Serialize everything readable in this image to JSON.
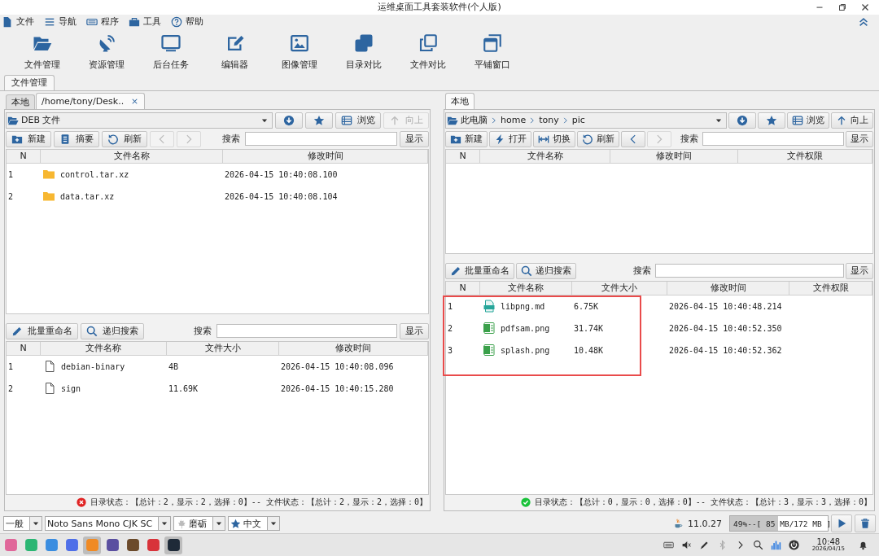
{
  "window": {
    "title": "运维桌面工具套装软件(个人版)"
  },
  "menu": [
    {
      "label": "文件",
      "kind": "file"
    },
    {
      "label": "导航",
      "kind": "menu"
    },
    {
      "label": "程序",
      "kind": "keyboard"
    },
    {
      "label": "工具",
      "kind": "toolbox"
    },
    {
      "label": "帮助",
      "kind": "help"
    }
  ],
  "toolbar": [
    {
      "label": "文件管理",
      "kind": "folder-open"
    },
    {
      "label": "资源管理",
      "kind": "satellite"
    },
    {
      "label": "后台任务",
      "kind": "monitor"
    },
    {
      "label": "编辑器",
      "kind": "edit"
    },
    {
      "label": "图像管理",
      "kind": "image"
    },
    {
      "label": "目录对比",
      "kind": "copy-filled"
    },
    {
      "label": "文件对比",
      "kind": "copy-outline"
    },
    {
      "label": "平铺窗口",
      "kind": "windows"
    }
  ],
  "main_tabs": [
    {
      "label": "文件管理",
      "selected": true
    }
  ],
  "panes": [
    {
      "tabs": [
        {
          "label": "本地",
          "selected": false,
          "closable": false
        },
        {
          "label": "/home/tony/Desk..",
          "selected": true,
          "closable": true
        }
      ],
      "path": [
        "DEB 文件"
      ],
      "nav": [
        {
          "kind": "download",
          "disabled": false
        },
        {
          "kind": "star",
          "disabled": false
        },
        {
          "label": "浏览",
          "kind": "list",
          "disabled": false
        },
        {
          "label": "向上",
          "kind": "up",
          "disabled": true
        }
      ],
      "toolbar": [
        {
          "label": "新建",
          "kind": "new",
          "disabled": false
        },
        {
          "label": "摘要",
          "kind": "summary",
          "disabled": false
        },
        {
          "label": "刷新",
          "kind": "refresh",
          "disabled": false
        },
        {
          "kind": "back",
          "disabled": true
        },
        {
          "kind": "forward",
          "disabled": true
        }
      ],
      "search_label": "搜索",
      "show_button": "显示",
      "dir_table": {
        "columns": [
          "N",
          "文件名称",
          "修改时间"
        ],
        "rows": [
          {
            "kind": "folder",
            "cells": [
              "1",
              "control.tar.xz",
              "2026-04-15 10:40:08.100"
            ]
          },
          {
            "kind": "folder",
            "cells": [
              "2",
              "data.tar.xz",
              "2026-04-15 10:40:08.104"
            ]
          }
        ]
      },
      "tools": [
        {
          "label": "批量重命名",
          "kind": "rename"
        },
        {
          "label": "递归搜索",
          "kind": "search"
        }
      ],
      "search_label_2": "搜索",
      "show_button_2": "显示",
      "file_table": {
        "columns": [
          "N",
          "文件名称",
          "文件大小",
          "修改时间"
        ],
        "rows": [
          {
            "kind": "doc",
            "cells": [
              "1",
              "debian-binary",
              "4B",
              "2026-04-15 10:40:08.096"
            ]
          },
          {
            "kind": "doc",
            "cells": [
              "2",
              "sign",
              "11.69K",
              "2026-04-15 10:40:15.280"
            ]
          }
        ]
      },
      "status": {
        "ok": false,
        "text": "目录状态：【总计：2，显示：2，选择：0】-- 文件状态：【总计：2，显示：2，选择：0】"
      }
    },
    {
      "tabs": [
        {
          "label": "本地",
          "selected": true,
          "closable": false
        }
      ],
      "path": [
        "此电脑",
        "home",
        "tony",
        "pic"
      ],
      "nav": [
        {
          "kind": "download",
          "disabled": false
        },
        {
          "kind": "star",
          "disabled": false
        },
        {
          "label": "浏览",
          "kind": "list",
          "disabled": false
        },
        {
          "label": "向上",
          "kind": "up",
          "disabled": false
        }
      ],
      "toolbar": [
        {
          "label": "新建",
          "kind": "new",
          "disabled": false
        },
        {
          "label": "打开",
          "kind": "open",
          "disabled": false
        },
        {
          "label": "切换",
          "kind": "switch",
          "disabled": false
        },
        {
          "label": "刷新",
          "kind": "refresh",
          "disabled": false
        },
        {
          "kind": "back",
          "disabled": false
        },
        {
          "kind": "forward",
          "disabled": true
        }
      ],
      "search_label": "搜索",
      "show_button": "显示",
      "dir_table": {
        "columns": [
          "N",
          "文件名称",
          "修改时间",
          "文件权限"
        ]
      },
      "tools": [
        {
          "label": "批量重命名",
          "kind": "rename"
        },
        {
          "label": "递归搜索",
          "kind": "search"
        }
      ],
      "search_label_2": "搜索",
      "show_button_2": "显示",
      "file_table": {
        "columns": [
          "N",
          "文件名称",
          "文件大小",
          "修改时间",
          "文件权限"
        ],
        "rows": [
          {
            "kind": "md",
            "cells": [
              "1",
              "libpng.md",
              "6.75K",
              "2026-04-15 10:40:48.214"
            ]
          },
          {
            "kind": "png",
            "cells": [
              "2",
              "pdfsam.png",
              "31.74K",
              "2026-04-15 10:40:52.350"
            ]
          },
          {
            "kind": "png",
            "cells": [
              "3",
              "splash.png",
              "10.48K",
              "2026-04-15 10:40:52.362"
            ]
          }
        ]
      },
      "highlight": true,
      "status": {
        "ok": true,
        "text": "目录状态：【总计：0，显示：0，选择：0】-- 文件状态：【总计：3，显示：3，选择：0】"
      }
    }
  ],
  "bottom_bar": {
    "selects": [
      {
        "value": "一般",
        "kind": "plain"
      },
      {
        "value": "Noto Sans Mono CJK SC",
        "kind": "plain"
      },
      {
        "value": "磨砺",
        "kind": "leaf"
      },
      {
        "value": "中文",
        "kind": "star"
      }
    ],
    "version": "11.0.27",
    "memory": {
      "text": "49%--[ 85 MB/172 MB ]",
      "level": 0.49
    }
  },
  "taskbar": {
    "apps": [
      {
        "color": "#e0679a",
        "active": false
      },
      {
        "color": "#2bb673",
        "active": false
      },
      {
        "color": "#3a8de0",
        "active": false
      },
      {
        "color": "#4f6fe8",
        "active": false
      },
      {
        "color": "#f08a24",
        "active": true
      },
      {
        "color": "#5a4fa0",
        "active": false
      },
      {
        "color": "#6b4a2b",
        "active": false
      },
      {
        "color": "#d8333a",
        "active": false
      },
      {
        "color": "#1e2a38",
        "active": true
      }
    ],
    "time": "10:48",
    "date": "2026/04/15"
  }
}
